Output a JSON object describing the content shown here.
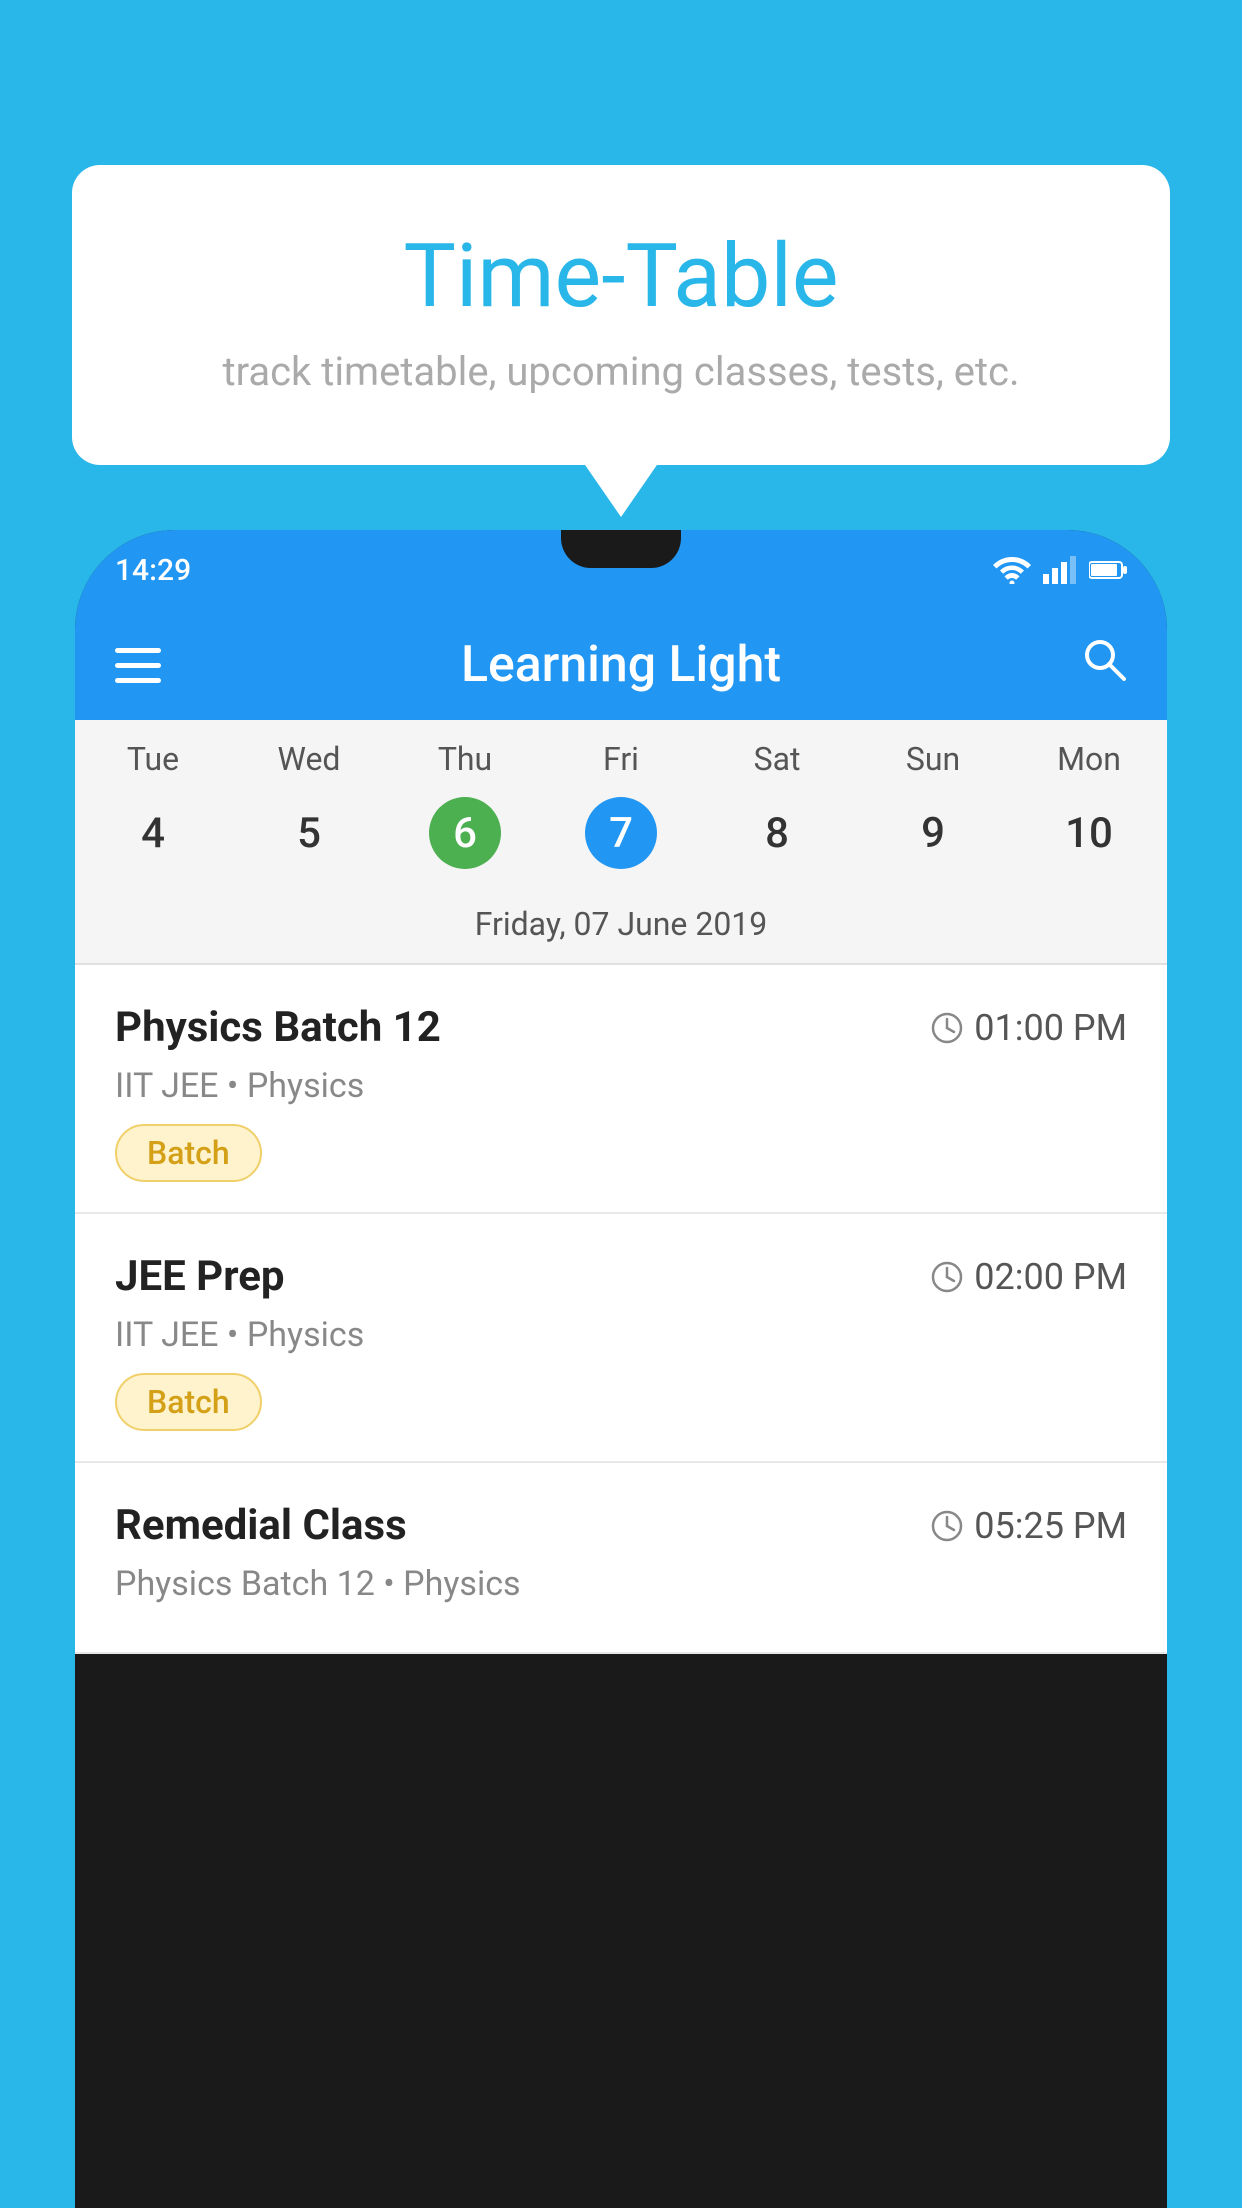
{
  "background_color": "#29b6e8",
  "tooltip": {
    "title": "Time-Table",
    "subtitle": "track timetable, upcoming classes, tests, etc."
  },
  "phone": {
    "status_bar": {
      "time": "14:29",
      "icons": [
        "wifi",
        "signal",
        "battery"
      ]
    },
    "app_bar": {
      "title": "Learning Light"
    },
    "calendar": {
      "days": [
        "Tue",
        "Wed",
        "Thu",
        "Fri",
        "Sat",
        "Sun",
        "Mon"
      ],
      "dates": [
        "4",
        "5",
        "6",
        "7",
        "8",
        "9",
        "10"
      ],
      "today_index": 2,
      "selected_index": 3,
      "selected_label": "Friday, 07 June 2019"
    },
    "schedule": [
      {
        "title": "Physics Batch 12",
        "time": "01:00 PM",
        "subtitle": "IIT JEE • Physics",
        "badge": "Batch"
      },
      {
        "title": "JEE Prep",
        "time": "02:00 PM",
        "subtitle": "IIT JEE • Physics",
        "badge": "Batch"
      },
      {
        "title": "Remedial Class",
        "time": "05:25 PM",
        "subtitle": "Physics Batch 12 • Physics",
        "badge": ""
      }
    ]
  }
}
